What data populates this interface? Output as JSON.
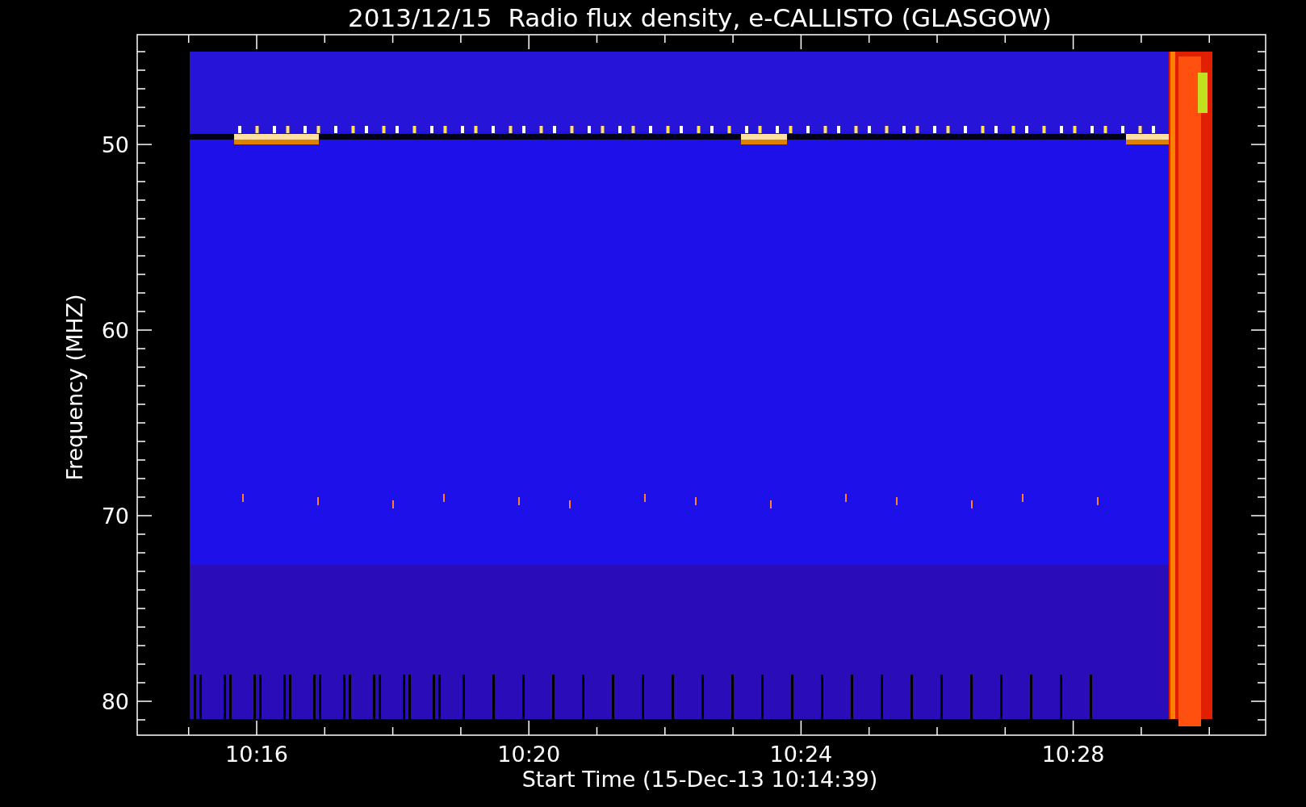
{
  "title": "2013/12/15  Radio flux density, e-CALLISTO (GLASGOW)",
  "y_axis": {
    "label": "Frequency (MHZ)",
    "ticks": [
      "50",
      "60",
      "70",
      "80"
    ]
  },
  "x_axis": {
    "label": "Start Time (15-Dec-13 10:14:39)",
    "ticks": [
      "10:16",
      "10:20",
      "10:24",
      "10:28"
    ]
  }
}
